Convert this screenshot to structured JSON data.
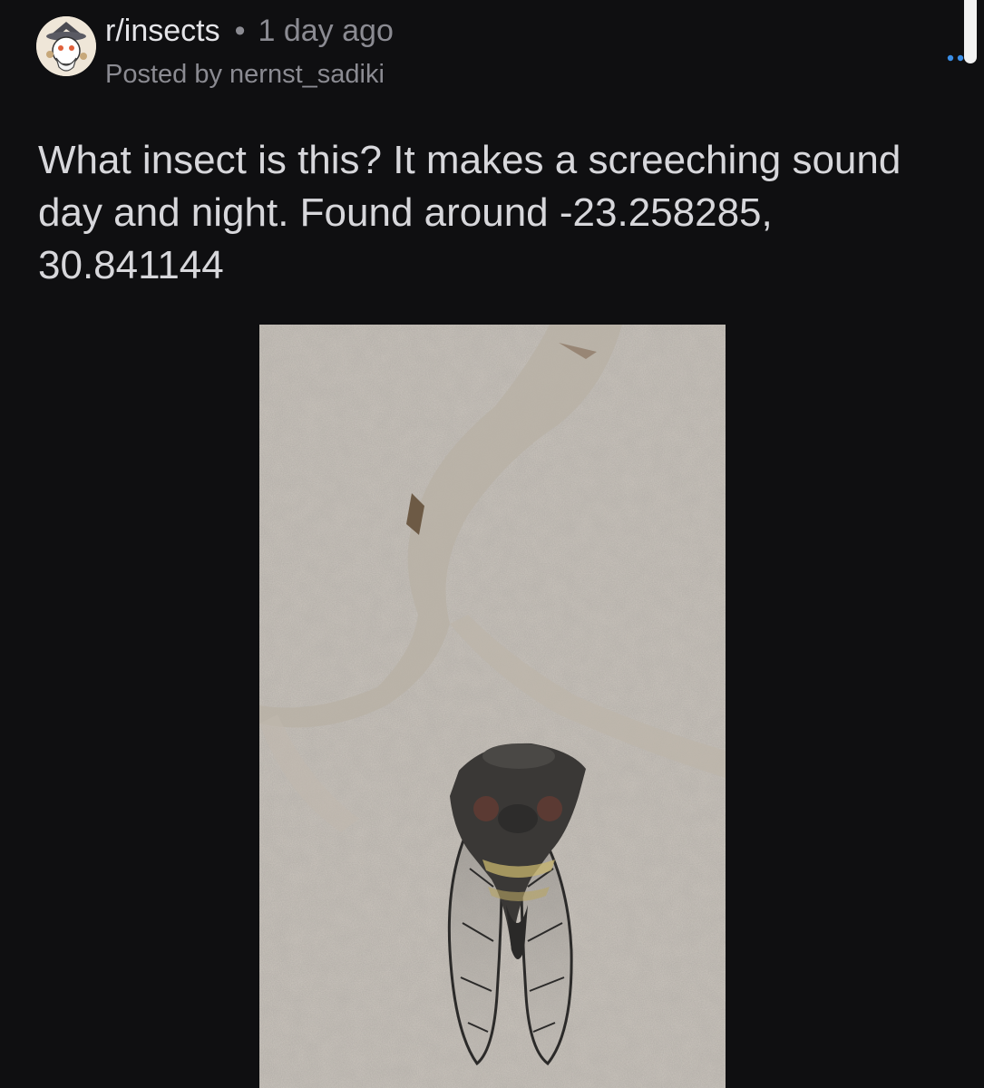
{
  "post": {
    "subreddit": "r/insects",
    "separator": "•",
    "time_ago": "1 day ago",
    "posted_by": "Posted by nernst_sadiki",
    "more_label": "...",
    "title": "What insect is this? It makes a screeching sound day and night. Found around -23.258285, 30.841144"
  },
  "icons": {
    "avatar": "snoo-wizard-avatar-icon",
    "more": "more-options-icon"
  },
  "colors": {
    "background": "#0f0f11",
    "text": "#d7d7db",
    "muted": "#8b8b92",
    "accent": "#3a8ee6"
  }
}
